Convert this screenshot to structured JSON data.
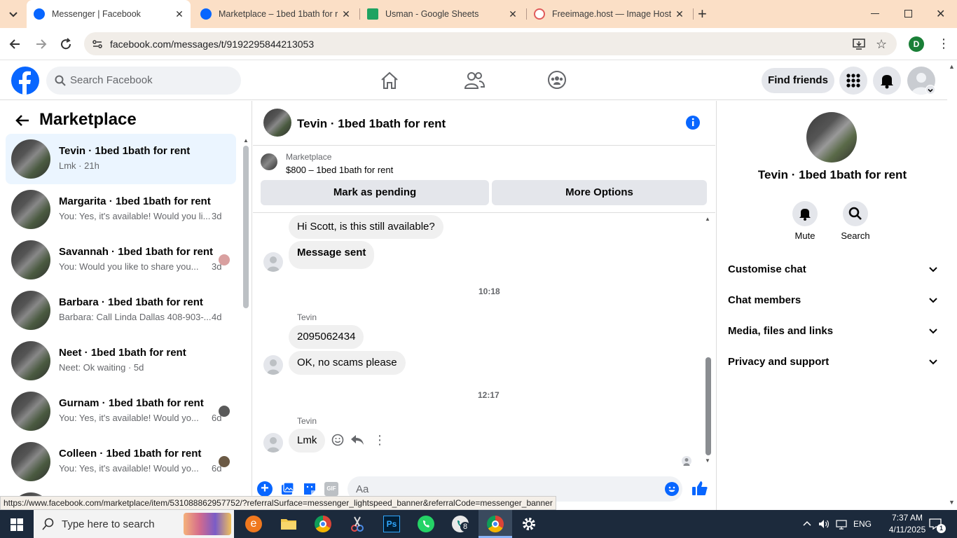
{
  "browser": {
    "tabs": [
      {
        "title": "Messenger | Facebook",
        "active": true
      },
      {
        "title": "Marketplace – 1bed 1bath for r",
        "active": false
      },
      {
        "title": "Usman - Google Sheets",
        "active": false
      },
      {
        "title": "Freeimage.host — Image Hostin",
        "active": false
      }
    ],
    "url": "facebook.com/messages/t/9192295844213053",
    "profile_initial": "D",
    "status_link": "https://www.facebook.com/marketplace/item/531088862957752/?referralSurface=messenger_lightspeed_banner&referralCode=messenger_banner"
  },
  "fb": {
    "search_placeholder": "Search Facebook",
    "find_friends": "Find friends"
  },
  "left": {
    "title": "Marketplace",
    "conversations": [
      {
        "name": "Tevin · 1bed 1bath for rent",
        "preview": "Lmk · 21h",
        "time": "",
        "selected": true,
        "mini": false
      },
      {
        "name": "Margarita · 1bed 1bath for rent",
        "preview": "You: Yes, it's available! Would you li...",
        "time": "3d",
        "selected": false,
        "mini": false
      },
      {
        "name": "Savannah · 1bed 1bath for rent",
        "preview": "You: Would you like to share you...",
        "time": "3d",
        "selected": false,
        "mini": true
      },
      {
        "name": "Barbara · 1bed 1bath for rent",
        "preview": "Barbara: Call Linda Dallas 408-903-...",
        "time": "4d",
        "selected": false,
        "mini": false
      },
      {
        "name": "Neet · 1bed 1bath for rent",
        "preview": "Neet: Ok waiting · 5d",
        "time": "",
        "selected": false,
        "mini": false
      },
      {
        "name": "Gurnam · 1bed 1bath for rent",
        "preview": "You: Yes, it's available! Would yo...",
        "time": "6d",
        "selected": false,
        "mini": true
      },
      {
        "name": "Colleen · 1bed 1bath for rent",
        "preview": "You: Yes, it's available! Would yo...",
        "time": "6d",
        "selected": false,
        "mini": true
      }
    ]
  },
  "chat": {
    "title": "Tevin · 1bed 1bath for rent",
    "listing_label": "Marketplace",
    "listing_title": "$800 – 1bed 1bath for rent",
    "mark_pending": "Mark as pending",
    "more_options": "More Options",
    "messages": {
      "m1": "Hi Scott, is this still available?",
      "m2": "Message sent",
      "ts1": "10:18",
      "sender1": "Tevin",
      "m3": "2095062434",
      "m4": "OK, no scams please",
      "ts2": "12:17",
      "sender2": "Tevin",
      "m5": "Lmk"
    },
    "composer_placeholder": "Aa"
  },
  "right": {
    "name": "Tevin · 1bed 1bath for rent",
    "mute": "Mute",
    "search": "Search",
    "sections": [
      "Customise chat",
      "Chat members",
      "Media, files and links",
      "Privacy and support"
    ]
  },
  "taskbar": {
    "search_placeholder": "Type here to search",
    "lang": "ENG",
    "time": "7:37 AM",
    "date": "4/11/2025",
    "whatsapp_badge": "8",
    "notif_count": "1"
  },
  "colors": {
    "fb_blue": "#0866ff",
    "tab_strip": "#fbdfc6",
    "taskbar": "#1c2a3c"
  }
}
